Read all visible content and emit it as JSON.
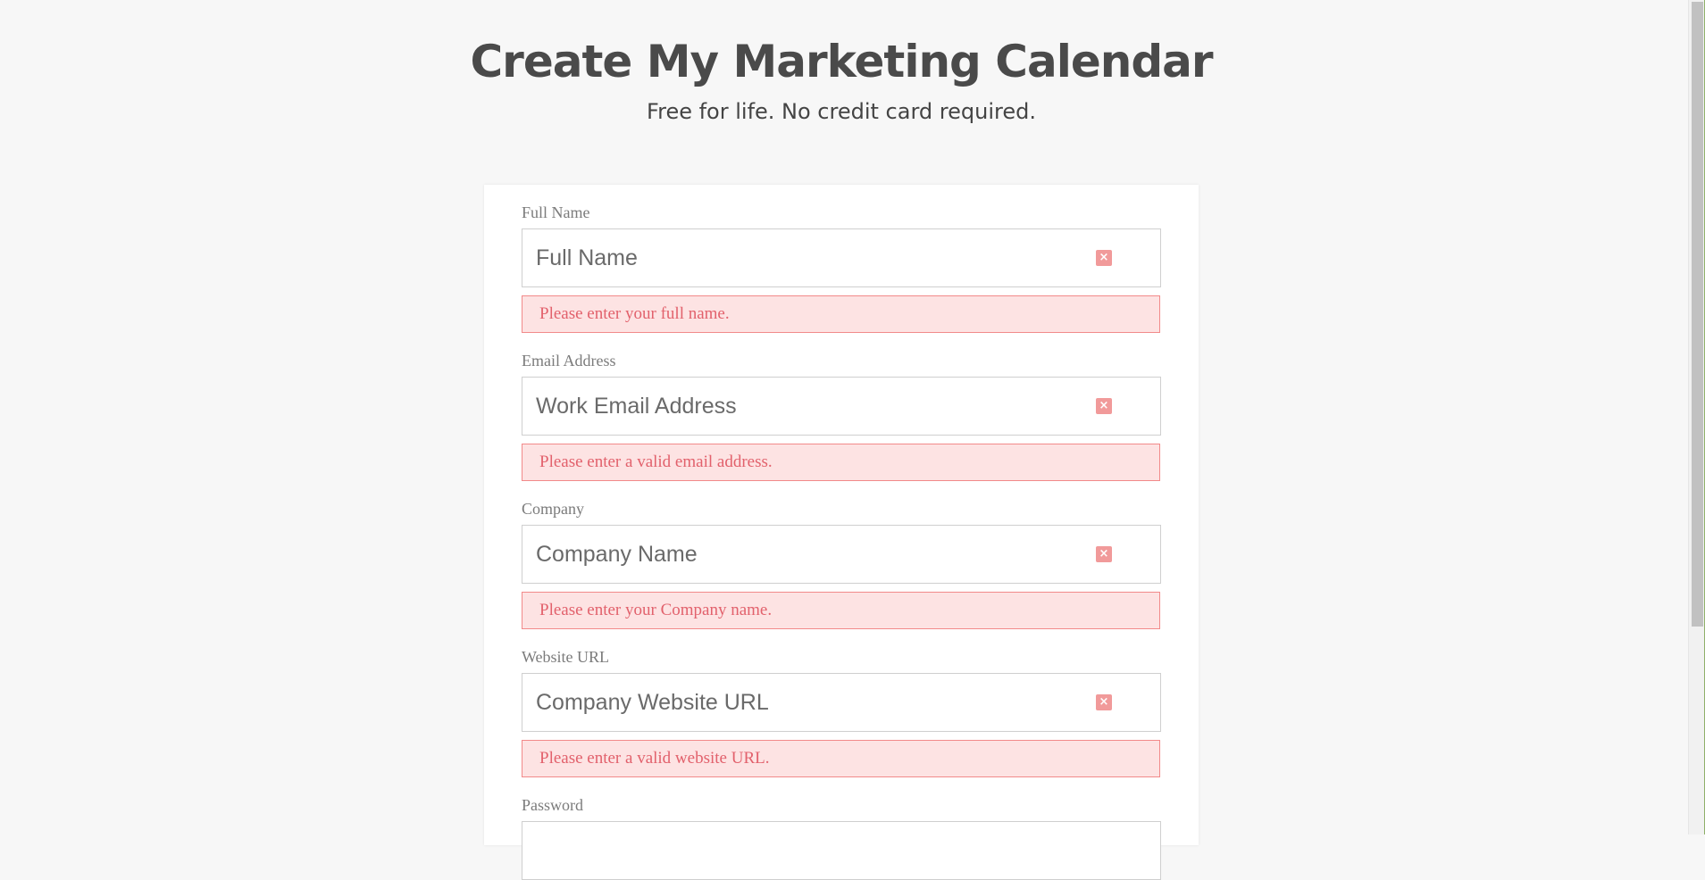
{
  "header": {
    "title": "Create My Marketing Calendar",
    "subtitle": "Free for life. No credit card required."
  },
  "form": {
    "fields": [
      {
        "label": "Full Name",
        "placeholder": "Full Name",
        "value": "",
        "error": "Please enter your full name.",
        "icon": "close-icon"
      },
      {
        "label": "Email Address",
        "placeholder": "Work Email Address",
        "value": "",
        "error": "Please enter a valid email address.",
        "icon": "close-icon"
      },
      {
        "label": "Company",
        "placeholder": "Company Name",
        "value": "",
        "error": "Please enter your Company name.",
        "icon": "close-icon"
      },
      {
        "label": "Website URL",
        "placeholder": "Company Website URL",
        "value": "",
        "error": "Please enter a valid website URL.",
        "icon": "close-icon"
      },
      {
        "label": "Password",
        "placeholder": "",
        "value": ""
      }
    ],
    "clear_glyph": "×"
  },
  "colors": {
    "page_background": "#f7f7f7",
    "title_text": "#4a4a4a",
    "error_text": "#e2616c",
    "error_background": "#fde3e3",
    "error_border": "#f28a8a",
    "clear_icon": "#f19a9a"
  }
}
